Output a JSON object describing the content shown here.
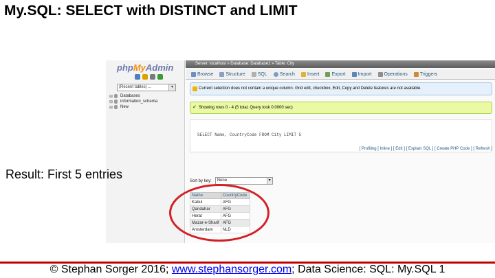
{
  "slide": {
    "title": "My.SQL: SELECT with DISTINCT and LIMIT",
    "result_caption": "Result: First 5 entries"
  },
  "footer": {
    "prefix": "© Stephan Sorger 2016; ",
    "link": "www.stephansorger.com",
    "suffix": "; Data Science: SQL: My.SQL 1"
  },
  "pma": {
    "logo": {
      "php": "php",
      "my": "My",
      "admin": "Admin"
    },
    "recent_tables": "(Recent tables) ...",
    "databases": [
      "Databases",
      "information_schema",
      "New"
    ],
    "breadcrumb": "Server: localhost » Database: Database1 » Table: City",
    "tabs": [
      "Browse",
      "Structure",
      "SQL",
      "Search",
      "Insert",
      "Export",
      "Import",
      "Operations",
      "Triggers"
    ],
    "notice": "Current selection does not contain a unique column. Grid edit, checkbox, Edit, Copy and Delete features are not available.",
    "success": "Showing rows 0 - 4 (5 total, Query took 0.0000 sec)",
    "sql": "SELECT Name, CountryCode FROM City LIMIT 5",
    "sql_links": "[ Profiling [ Inline ] [ Edit ] [ Explain SQL ] [ Create PHP Code ] [ Refresh ]",
    "sort_label": "Sort by key:",
    "sort_value": "None",
    "table": {
      "headers": [
        "Name",
        "CountryCode"
      ],
      "rows": [
        [
          "Kabul",
          "AFG"
        ],
        [
          "Qandahar",
          "AFG"
        ],
        [
          "Herat",
          "AFG"
        ],
        [
          "Mazar-e-Sharif",
          "AFG"
        ],
        [
          "Amsterdam",
          "NLD"
        ]
      ]
    }
  },
  "colors": {
    "title_rule": "#c00000",
    "highlight": "#d32027",
    "notice_bg": "#e5f0fa",
    "success_bg": "#ebf8a4"
  }
}
